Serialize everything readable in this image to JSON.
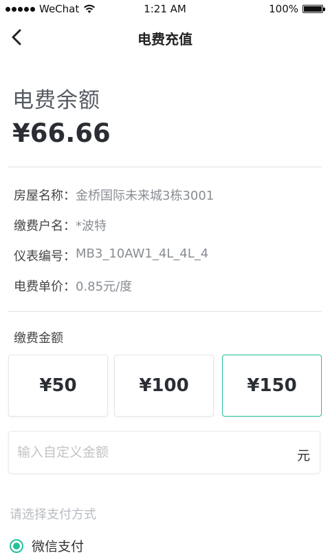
{
  "status_bar": {
    "carrier": "WeChat",
    "time": "1:21 AM",
    "battery": "100%"
  },
  "nav": {
    "title": "电费充值",
    "back_icon": "chevron-left-icon"
  },
  "balance": {
    "label": "电费余额",
    "value": "¥66.66"
  },
  "info": [
    {
      "key": "房屋名称：",
      "value": "金桥国际未来城3栋3001"
    },
    {
      "key": "缴费户名：",
      "value": "*波特"
    },
    {
      "key": "仪表编号：",
      "value": "MB3_10AW1_4L_4L_4"
    },
    {
      "key": "电费单价：",
      "value": "0.85元/度"
    }
  ],
  "amount_section": {
    "label": "缴费金额",
    "options": [
      "¥50",
      "¥100",
      "¥150"
    ],
    "selected": "¥150"
  },
  "custom_amount": {
    "placeholder": "输入自定义金额",
    "unit": "元"
  },
  "payment": {
    "label": "请选择支付方式",
    "method": "微信支付"
  },
  "colors": {
    "accent": "#25c19a",
    "text_dark": "#2a2e34",
    "text_muted": "#888d93"
  }
}
